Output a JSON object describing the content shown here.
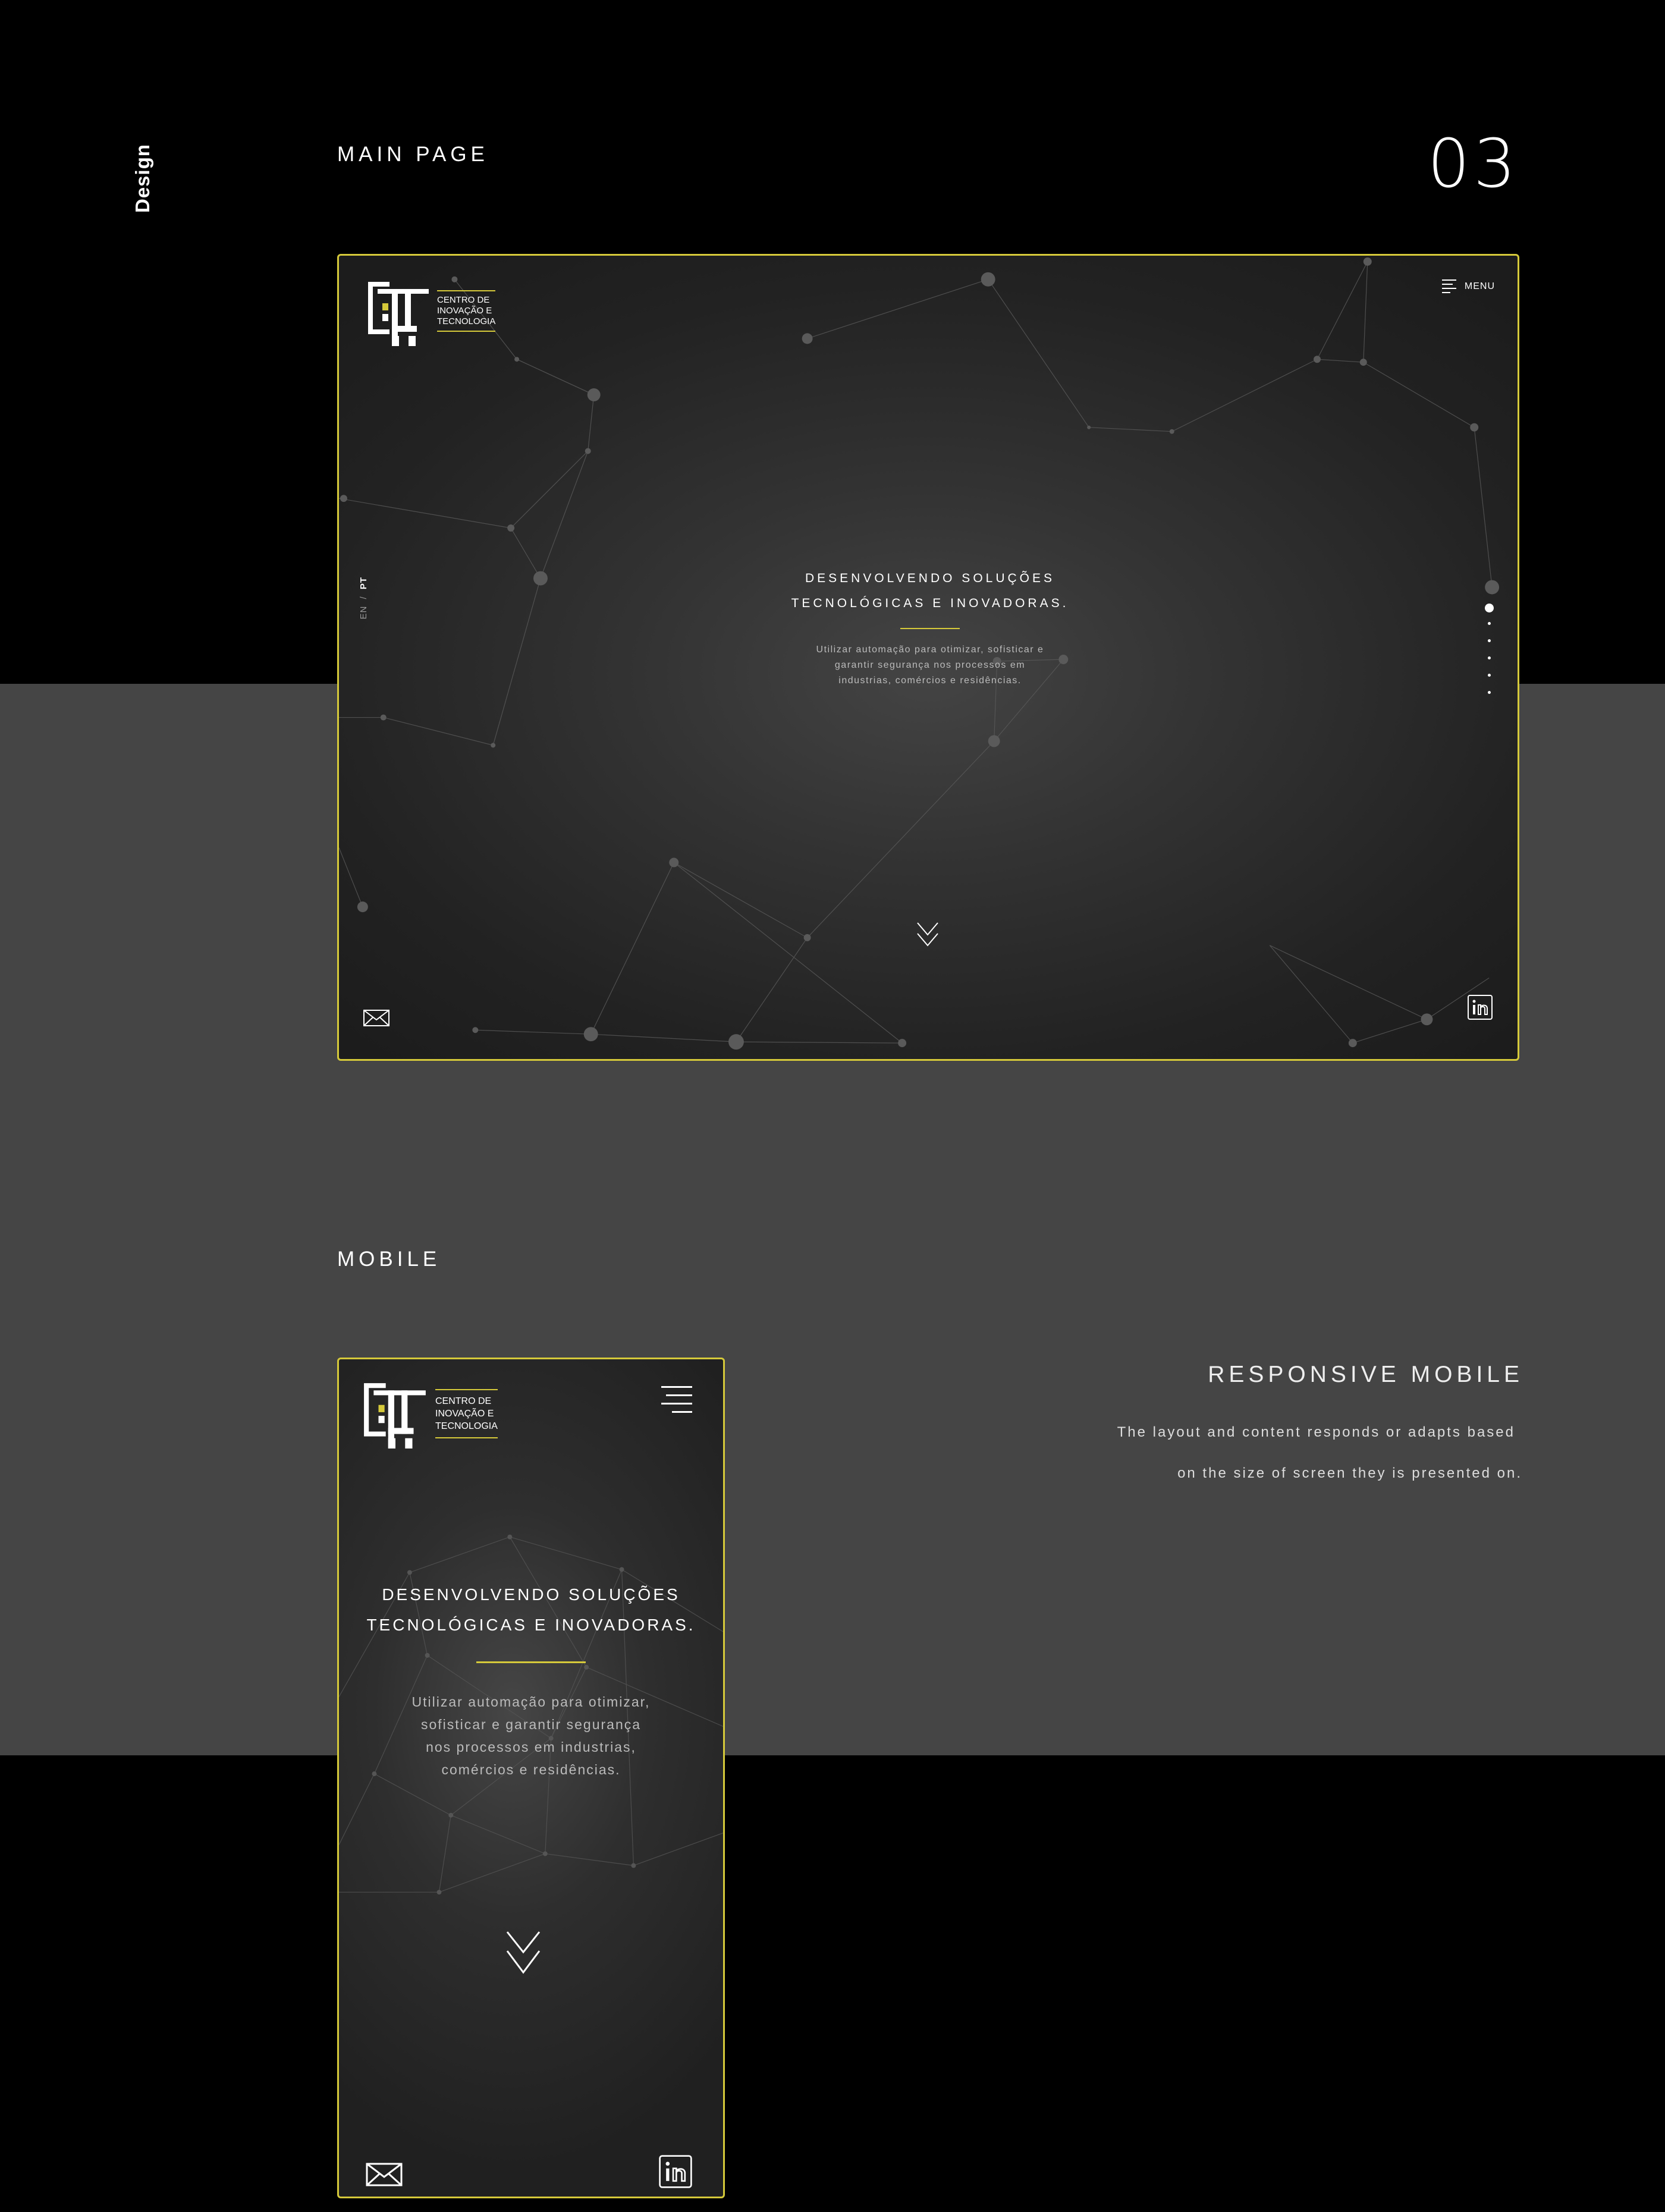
{
  "side_label": "Design",
  "page_number": "03",
  "sections": {
    "main": "MAIN PAGE",
    "mobile": "MOBILE"
  },
  "brand": {
    "line1": "CENTRO DE",
    "line2": "INOVAÇÃO E",
    "line3": "TECNOLOGIA"
  },
  "desktop": {
    "menu_label": "MENU",
    "lang_en": "EN",
    "lang_sep": "/",
    "lang_pt": "PT",
    "hero_title_1": "DESENVOLVENDO SOLUÇÕES",
    "hero_title_2": "TECNOLÓGICAS E INOVADORAS.",
    "hero_desc_1": "Utilizar automação para otimizar, sofisticar e",
    "hero_desc_2": "garantir segurança nos processos em",
    "hero_desc_3": "industrias, comércios e residências."
  },
  "mobile": {
    "hero_title_1": "DESENVOLVENDO SOLUÇÕES",
    "hero_title_2": "TECNOLÓGICAS E INOVADORAS.",
    "hero_desc_1": "Utilizar automação para otimizar,",
    "hero_desc_2": "sofisticar e garantir segurança",
    "hero_desc_3": "nos processos em industrias,",
    "hero_desc_4": "comércios e residências."
  },
  "responsive": {
    "title": "RESPONSIVE MOBILE",
    "text_1": "The layout and content responds or adapts based",
    "text_2": "on the size of screen they is presented on."
  },
  "colors": {
    "accent": "#d5c93a",
    "background_dark": "#000000",
    "background_gray": "#454545"
  },
  "icons": [
    "menu-icon",
    "chevron-down-icon",
    "mail-icon",
    "linkedin-icon",
    "logo-icon"
  ]
}
